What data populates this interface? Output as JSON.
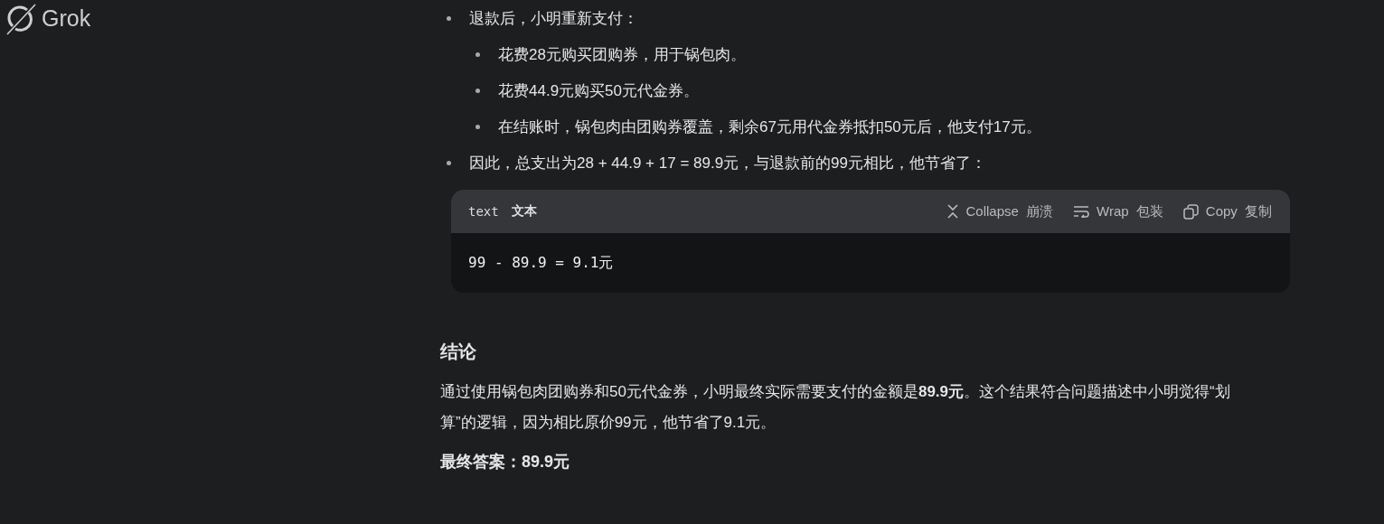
{
  "logo": {
    "text": "Grok"
  },
  "bullets": [
    {
      "text": "退款后，小明重新支付：",
      "children": [
        {
          "text": "花费28元购买团购券，用于锅包肉。"
        },
        {
          "text": "花费44.9元购买50元代金券。"
        },
        {
          "text": "在结账时，锅包肉由团购券覆盖，剩余67元用代金券抵扣50元后，他支付17元。"
        }
      ]
    },
    {
      "text": "因此，总支出为28 + 44.9 + 17 = 89.9元，与退款前的99元相比，他节省了："
    }
  ],
  "code_block": {
    "language": "text",
    "language_label": "文本",
    "actions": [
      {
        "kind": "collapse",
        "label": "Collapse 崩溃"
      },
      {
        "kind": "wrap",
        "label": "Wrap 包装"
      },
      {
        "kind": "copy",
        "label": "Copy 复制"
      }
    ],
    "code": "99 - 89.9 = 9.1元"
  },
  "conclusion": {
    "heading": "结论",
    "paragraph": "通过使用锅包肉团购券和50元代金券，小明最终实际需要支付的金额是**89.9元**。这个结果符合问题描述中小明觉得“划算”的逻辑，因为相比原价99元，他节省了9.1元。",
    "final_answer": "最终答案：89.9元"
  }
}
